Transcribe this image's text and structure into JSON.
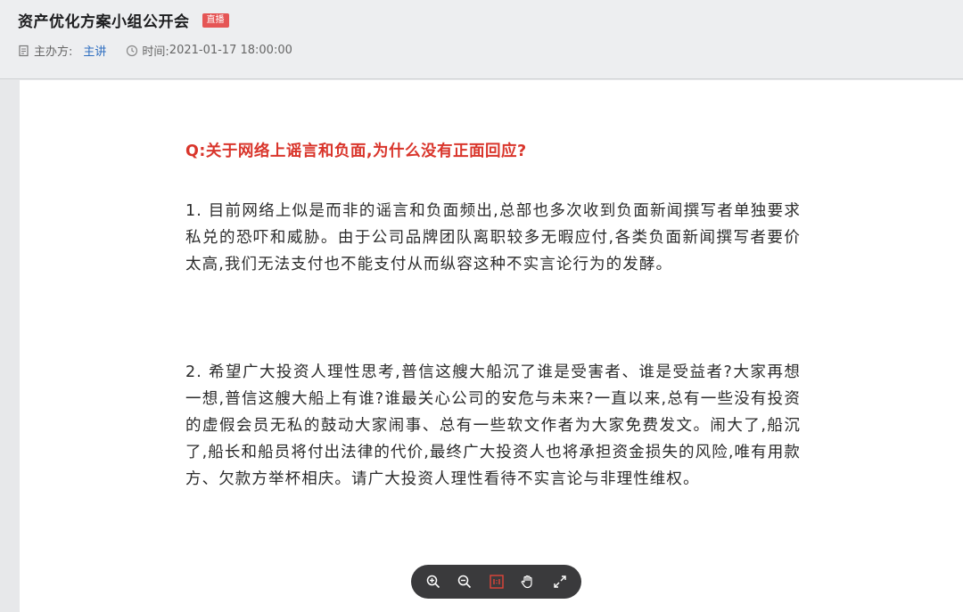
{
  "header": {
    "title": "资产优化方案小组公开会",
    "badge": "直播",
    "host_label": "主办方:",
    "host_value": "主讲",
    "time_label": "时间:",
    "time_value": "2021-01-17 18:00:00"
  },
  "document": {
    "question": "Q:关于网络上谣言和负面,为什么没有正面回应?",
    "paragraphs": [
      "1. 目前网络上似是而非的谣言和负面频出,总部也多次收到负面新闻撰写者单独要求私兑的恐吓和威胁。由于公司品牌团队离职较多无暇应付,各类负面新闻撰写者要价太高,我们无法支付也不能支付从而纵容这种不实言论行为的发酵。",
      "2. 希望广大投资人理性思考,普信这艘大船沉了谁是受害者、谁是受益者?大家再想一想,普信这艘大船上有谁?谁最关心公司的安危与未来?一直以来,总有一些没有投资的虚假会员无私的鼓动大家闹事、总有一些软文作者为大家免费发文。闹大了,船沉了,船长和船员将付出法律的代价,最终广大投资人也将承担资金损失的风险,唯有用款方、欠款方举杯相庆。请广大投资人理性看待不实言论与非理性维权。"
    ]
  },
  "toolbar": {
    "buttons": [
      "zoom-in-icon",
      "zoom-out-icon",
      "actual-size-icon",
      "hand-icon",
      "fullscreen-icon"
    ],
    "active_color": "#e0453a"
  },
  "colors": {
    "accent_red": "#d9352b",
    "link_blue": "#2f6fc0"
  }
}
